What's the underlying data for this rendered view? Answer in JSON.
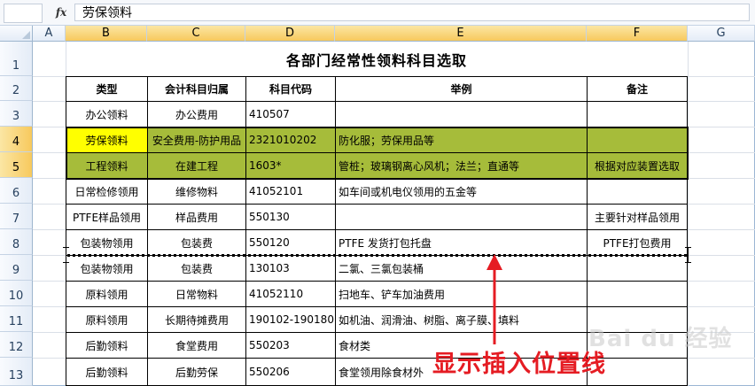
{
  "formula_bar": {
    "fx_label": "fx",
    "content": "劳保领料"
  },
  "columns": [
    "A",
    "B",
    "C",
    "D",
    "E",
    "F",
    "G"
  ],
  "rows": [
    "1",
    "2",
    "3",
    "4",
    "5",
    "6",
    "7",
    "8",
    "9",
    "10",
    "11",
    "12",
    "13"
  ],
  "sheet": {
    "title": "各部门经常性领料科目选取",
    "headers": [
      "类型",
      "会计科目归属",
      "科目代码",
      "举例",
      "备注"
    ],
    "data": [
      [
        "办公领料",
        "办公费用",
        "410507",
        "",
        ""
      ],
      [
        "劳保领料",
        "安全费用-防护用品",
        "2321010202",
        "防化服；劳保用品等",
        ""
      ],
      [
        "工程领料",
        "在建工程",
        "1603*",
        "管桩；玻璃钢离心风机；法兰；直通等",
        "根据对应装置选取"
      ],
      [
        "日常检修领用",
        "维修物料",
        "41052101",
        "如车间或机电仪领用的五金等",
        ""
      ],
      [
        "PTFE样品领用",
        "样品费用",
        "550130",
        "",
        "主要针对样品领用"
      ],
      [
        "包装物领用",
        "包装费",
        "550120",
        "PTFE 发货打包托盘",
        "PTFE打包费用"
      ],
      [
        "包装物领用",
        "包装费",
        "130103",
        "二氯、三氯包装桶",
        ""
      ],
      [
        "原料领用",
        "日常物料",
        "41052110",
        "扫地车、铲车加油费用",
        ""
      ],
      [
        "原料领用",
        "长期待摊费用",
        "190102-190180",
        "如机油、润滑油、树脂、离子膜、填料",
        ""
      ],
      [
        "后勤领料",
        "食堂费用",
        "550203",
        "食材类",
        ""
      ],
      [
        "后勤领料",
        "后勤劳保",
        "550206",
        "食堂领用除食材外",
        ""
      ]
    ]
  },
  "annotation": {
    "text": "显示插入位置线",
    "color": "#e51c23"
  },
  "watermark": "Bai du 经验",
  "colors": {
    "highlight_green": "#a6bc3a",
    "highlight_yellow": "#ffff00",
    "header_selected": "#f7c95d"
  }
}
